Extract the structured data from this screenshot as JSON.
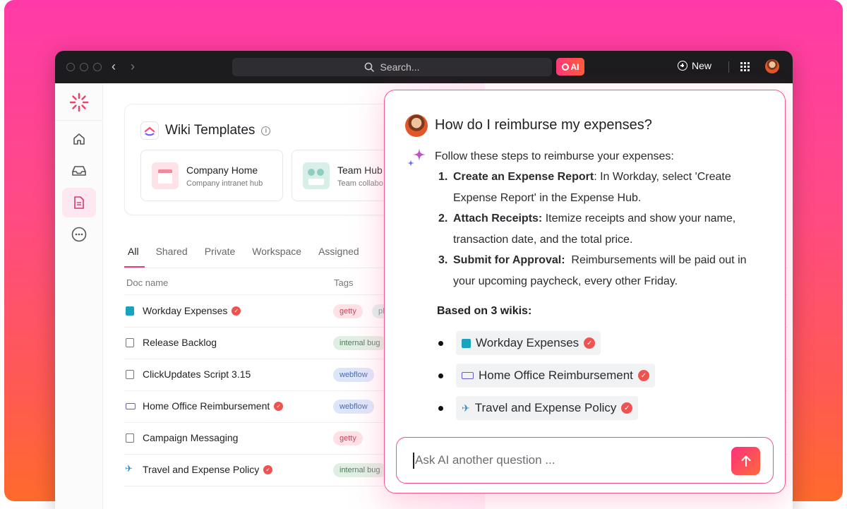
{
  "titlebar": {
    "search_placeholder": "Search...",
    "ai_label": "AI",
    "new_label": "New"
  },
  "wiki": {
    "title": "Wiki Templates",
    "templates": [
      {
        "name": "Company Home",
        "subtitle": "Company intranet hub"
      },
      {
        "name": "Team Hub",
        "subtitle": "Team collabo"
      }
    ]
  },
  "tabs": [
    {
      "label": "All",
      "active": true
    },
    {
      "label": "Shared"
    },
    {
      "label": "Private"
    },
    {
      "label": "Workspace"
    },
    {
      "label": "Assigned"
    }
  ],
  "table": {
    "columns": [
      "Doc name",
      "Tags"
    ],
    "rows": [
      {
        "name": "Workday Expenses",
        "icon": "workday-icon",
        "verified": true,
        "tag": "getty",
        "tag2": "pl"
      },
      {
        "name": "Release Backlog",
        "icon": "doc-icon",
        "verified": false,
        "tag": "internal bug"
      },
      {
        "name": "ClickUpdates Script 3.15",
        "icon": "doc-icon",
        "verified": false,
        "tag": "webflow"
      },
      {
        "name": "Home Office Reimbursement",
        "icon": "keyboard-icon",
        "verified": true,
        "tag": "webflow"
      },
      {
        "name": "Campaign Messaging",
        "icon": "doc-icon",
        "verified": false,
        "tag": "getty"
      },
      {
        "name": "Travel and Expense Policy",
        "icon": "airplane-icon",
        "verified": true,
        "tag": "internal bug"
      }
    ]
  },
  "ai_panel": {
    "question": "How do I reimburse my expenses?",
    "intro": "Follow these steps to reimburse your expenses:",
    "steps": [
      {
        "num": "1.",
        "title": "Create an Expense Report",
        "sep": ": ",
        "text": "In Workday, select 'Create Expense Report' in the Expense Hub."
      },
      {
        "num": "2.",
        "title": "Attach Receipts:",
        "sep": " ",
        "text": "Itemize receipts and show your name, transaction date, and the total price."
      },
      {
        "num": "3.",
        "title": "Submit for Approval:",
        "sep": "  ",
        "text": "Reimbursements will be paid out in your upcoming paycheck, every other Friday."
      }
    ],
    "based_on": "Based on 3 wikis:",
    "sources": [
      {
        "name": "Workday Expenses",
        "icon": "workday-icon"
      },
      {
        "name": "Home Office Reimbursement",
        "icon": "keyboard-icon"
      },
      {
        "name": "Travel and Expense Policy",
        "icon": "airplane-icon"
      }
    ],
    "input_placeholder": "Ask AI another question ..."
  },
  "colors": {
    "accent": "#f0507f",
    "verified": "#ef5350"
  }
}
